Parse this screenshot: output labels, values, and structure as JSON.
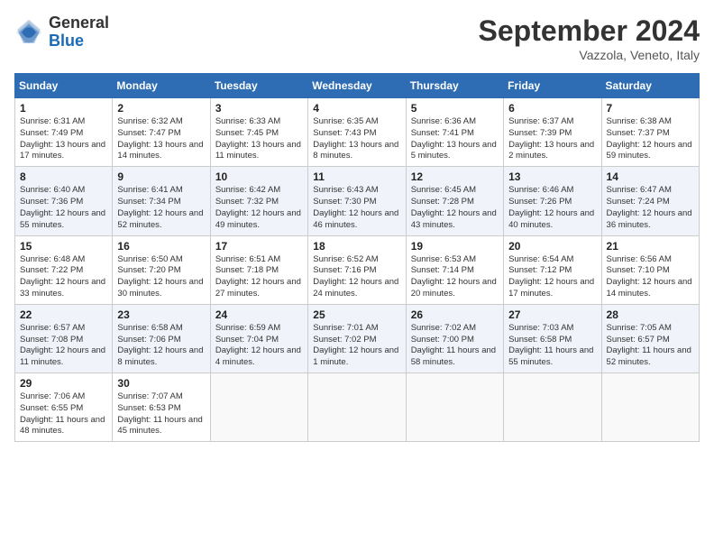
{
  "header": {
    "logo_general": "General",
    "logo_blue": "Blue",
    "month_title": "September 2024",
    "location": "Vazzola, Veneto, Italy"
  },
  "days_of_week": [
    "Sunday",
    "Monday",
    "Tuesday",
    "Wednesday",
    "Thursday",
    "Friday",
    "Saturday"
  ],
  "weeks": [
    [
      {
        "day": "1",
        "sunrise": "6:31 AM",
        "sunset": "7:49 PM",
        "daylight": "13 hours and 17 minutes."
      },
      {
        "day": "2",
        "sunrise": "6:32 AM",
        "sunset": "7:47 PM",
        "daylight": "13 hours and 14 minutes."
      },
      {
        "day": "3",
        "sunrise": "6:33 AM",
        "sunset": "7:45 PM",
        "daylight": "13 hours and 11 minutes."
      },
      {
        "day": "4",
        "sunrise": "6:35 AM",
        "sunset": "7:43 PM",
        "daylight": "13 hours and 8 minutes."
      },
      {
        "day": "5",
        "sunrise": "6:36 AM",
        "sunset": "7:41 PM",
        "daylight": "13 hours and 5 minutes."
      },
      {
        "day": "6",
        "sunrise": "6:37 AM",
        "sunset": "7:39 PM",
        "daylight": "13 hours and 2 minutes."
      },
      {
        "day": "7",
        "sunrise": "6:38 AM",
        "sunset": "7:37 PM",
        "daylight": "12 hours and 59 minutes."
      }
    ],
    [
      {
        "day": "8",
        "sunrise": "6:40 AM",
        "sunset": "7:36 PM",
        "daylight": "12 hours and 55 minutes."
      },
      {
        "day": "9",
        "sunrise": "6:41 AM",
        "sunset": "7:34 PM",
        "daylight": "12 hours and 52 minutes."
      },
      {
        "day": "10",
        "sunrise": "6:42 AM",
        "sunset": "7:32 PM",
        "daylight": "12 hours and 49 minutes."
      },
      {
        "day": "11",
        "sunrise": "6:43 AM",
        "sunset": "7:30 PM",
        "daylight": "12 hours and 46 minutes."
      },
      {
        "day": "12",
        "sunrise": "6:45 AM",
        "sunset": "7:28 PM",
        "daylight": "12 hours and 43 minutes."
      },
      {
        "day": "13",
        "sunrise": "6:46 AM",
        "sunset": "7:26 PM",
        "daylight": "12 hours and 40 minutes."
      },
      {
        "day": "14",
        "sunrise": "6:47 AM",
        "sunset": "7:24 PM",
        "daylight": "12 hours and 36 minutes."
      }
    ],
    [
      {
        "day": "15",
        "sunrise": "6:48 AM",
        "sunset": "7:22 PM",
        "daylight": "12 hours and 33 minutes."
      },
      {
        "day": "16",
        "sunrise": "6:50 AM",
        "sunset": "7:20 PM",
        "daylight": "12 hours and 30 minutes."
      },
      {
        "day": "17",
        "sunrise": "6:51 AM",
        "sunset": "7:18 PM",
        "daylight": "12 hours and 27 minutes."
      },
      {
        "day": "18",
        "sunrise": "6:52 AM",
        "sunset": "7:16 PM",
        "daylight": "12 hours and 24 minutes."
      },
      {
        "day": "19",
        "sunrise": "6:53 AM",
        "sunset": "7:14 PM",
        "daylight": "12 hours and 20 minutes."
      },
      {
        "day": "20",
        "sunrise": "6:54 AM",
        "sunset": "7:12 PM",
        "daylight": "12 hours and 17 minutes."
      },
      {
        "day": "21",
        "sunrise": "6:56 AM",
        "sunset": "7:10 PM",
        "daylight": "12 hours and 14 minutes."
      }
    ],
    [
      {
        "day": "22",
        "sunrise": "6:57 AM",
        "sunset": "7:08 PM",
        "daylight": "12 hours and 11 minutes."
      },
      {
        "day": "23",
        "sunrise": "6:58 AM",
        "sunset": "7:06 PM",
        "daylight": "12 hours and 8 minutes."
      },
      {
        "day": "24",
        "sunrise": "6:59 AM",
        "sunset": "7:04 PM",
        "daylight": "12 hours and 4 minutes."
      },
      {
        "day": "25",
        "sunrise": "7:01 AM",
        "sunset": "7:02 PM",
        "daylight": "12 hours and 1 minute."
      },
      {
        "day": "26",
        "sunrise": "7:02 AM",
        "sunset": "7:00 PM",
        "daylight": "11 hours and 58 minutes."
      },
      {
        "day": "27",
        "sunrise": "7:03 AM",
        "sunset": "6:58 PM",
        "daylight": "11 hours and 55 minutes."
      },
      {
        "day": "28",
        "sunrise": "7:05 AM",
        "sunset": "6:57 PM",
        "daylight": "11 hours and 52 minutes."
      }
    ],
    [
      {
        "day": "29",
        "sunrise": "7:06 AM",
        "sunset": "6:55 PM",
        "daylight": "11 hours and 48 minutes."
      },
      {
        "day": "30",
        "sunrise": "7:07 AM",
        "sunset": "6:53 PM",
        "daylight": "11 hours and 45 minutes."
      },
      null,
      null,
      null,
      null,
      null
    ]
  ]
}
